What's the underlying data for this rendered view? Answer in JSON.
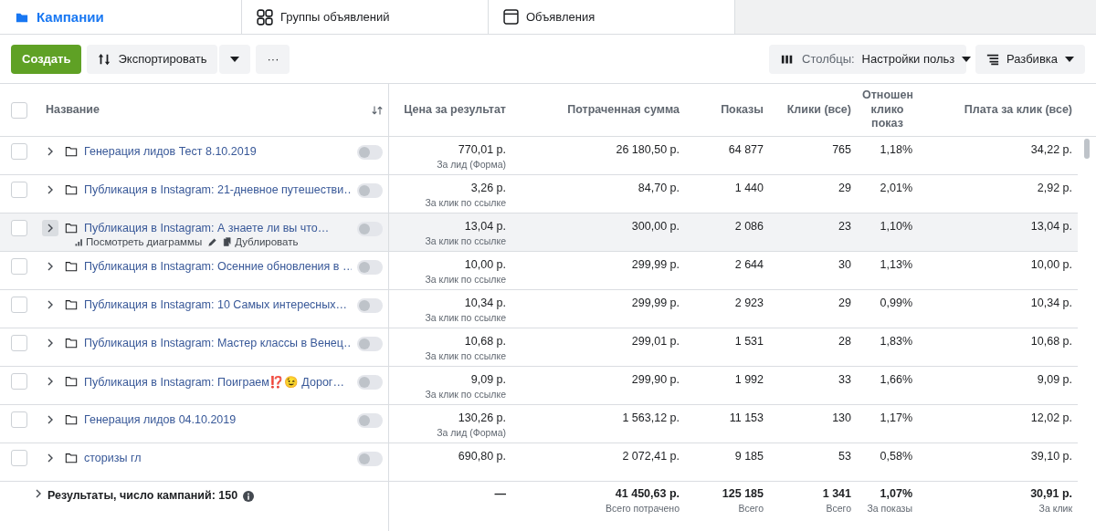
{
  "tabs": [
    {
      "label": "Кампании",
      "kind": "folder",
      "selected": true
    },
    {
      "label": "Группы объявлений",
      "kind": "grid",
      "selected": false
    },
    {
      "label": "Объявления",
      "kind": "window",
      "selected": false
    }
  ],
  "toolbar": {
    "create": "Создать",
    "export": "Экспортировать",
    "more": "···",
    "columns_label": "Столбцы:",
    "columns_value": "Настройки польз",
    "breakdown": "Разбивка"
  },
  "table": {
    "select_all_checked": false,
    "columns": [
      {
        "label": "Название"
      },
      {
        "label": "Цена за результат"
      },
      {
        "label": "Потраченная сумма"
      },
      {
        "label": "Показы"
      },
      {
        "label": "Клики (все)"
      },
      {
        "label": "Отношен клико показ"
      },
      {
        "label": "Плата за клик (все)"
      }
    ],
    "rows": [
      {
        "name": "Генерация лидов Тест 8.10.2019",
        "checked": false,
        "on": false,
        "hovered": false,
        "price": "770,01 р.",
        "price_note": "За лид (Форма)",
        "spent": "26 180,50 р.",
        "impressions": "64 877",
        "clicks": "765",
        "ctr": "1,18%",
        "cpc": "34,22 р."
      },
      {
        "name": "Публикация в Instagram: 21-дневное путешестви…",
        "checked": false,
        "on": false,
        "hovered": false,
        "price": "3,26 р.",
        "price_note": "За клик по ссылке",
        "spent": "84,70 р.",
        "impressions": "1 440",
        "clicks": "29",
        "ctr": "2,01%",
        "cpc": "2,92 р."
      },
      {
        "name": "Публикация в Instagram: А знаете ли вы что…",
        "checked": false,
        "on": false,
        "hovered": true,
        "actions": [
          "Посмотреть диаграммы",
          "Дублировать"
        ],
        "price": "13,04 р.",
        "price_note": "За клик по ссылке",
        "spent": "300,00 р.",
        "impressions": "2 086",
        "clicks": "23",
        "ctr": "1,10%",
        "cpc": "13,04 р."
      },
      {
        "name": "Публикация в Instagram: Осенние обновления в …",
        "checked": false,
        "on": false,
        "hovered": false,
        "price": "10,00 р.",
        "price_note": "За клик по ссылке",
        "spent": "299,99 р.",
        "impressions": "2 644",
        "clicks": "30",
        "ctr": "1,13%",
        "cpc": "10,00 р."
      },
      {
        "name": "Публикация в Instagram: 10 Самых интересных…",
        "checked": false,
        "on": false,
        "hovered": false,
        "price": "10,34 р.",
        "price_note": "За клик по ссылке",
        "spent": "299,99 р.",
        "impressions": "2 923",
        "clicks": "29",
        "ctr": "0,99%",
        "cpc": "10,34 р."
      },
      {
        "name": "Публикация в Instagram: Мастер классы в Венец…",
        "checked": false,
        "on": false,
        "hovered": false,
        "price": "10,68 р.",
        "price_note": "За клик по ссылке",
        "spent": "299,01 р.",
        "impressions": "1 531",
        "clicks": "28",
        "ctr": "1,83%",
        "cpc": "10,68 р."
      },
      {
        "name": "Публикация в Instagram: Поиграем⁉️😉   Дорог…",
        "checked": false,
        "on": false,
        "hovered": false,
        "price": "9,09 р.",
        "price_note": "За клик по ссылке",
        "spent": "299,90 р.",
        "impressions": "1 992",
        "clicks": "33",
        "ctr": "1,66%",
        "cpc": "9,09 р."
      },
      {
        "name": "Генерация лидов 04.10.2019",
        "checked": false,
        "on": false,
        "hovered": false,
        "price": "130,26 р.",
        "price_note": "За лид (Форма)",
        "spent": "1 563,12 р.",
        "impressions": "11 153",
        "clicks": "130",
        "ctr": "1,17%",
        "cpc": "12,02 р."
      },
      {
        "name": "сторизы гл",
        "checked": false,
        "on": false,
        "hovered": false,
        "price": "690,80 р.",
        "spent": "2 072,41 р.",
        "impressions": "9 185",
        "clicks": "53",
        "ctr": "0,58%",
        "cpc": "39,10 р."
      }
    ],
    "footer": {
      "label": "Результаты, число кампаний: 150",
      "cells": [
        {
          "value": "—"
        },
        {
          "value": "41 450,63 р.",
          "note": "Всего потрачено"
        },
        {
          "value": "125 185",
          "note": "Всего"
        },
        {
          "value": "1 341",
          "note": "Всего"
        },
        {
          "value": "1,07%",
          "note": "За показы"
        },
        {
          "value": "30,91 р.",
          "note": "За клик"
        }
      ]
    }
  }
}
